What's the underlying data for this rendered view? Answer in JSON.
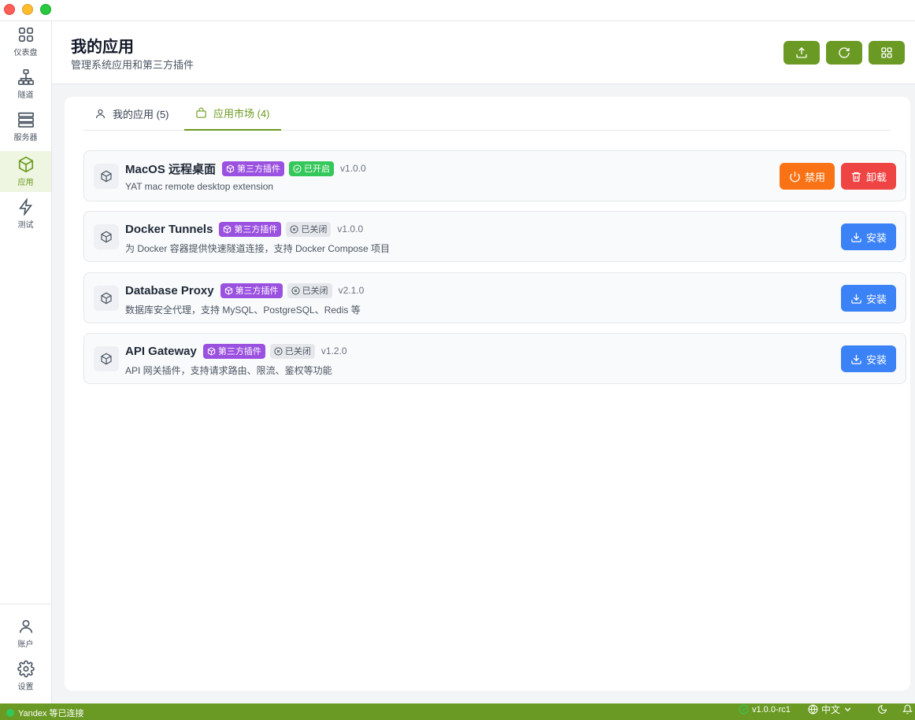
{
  "header": {
    "title": "我的应用",
    "subtitle": "管理系统应用和第三方插件",
    "buttons": [
      "upload-icon",
      "refresh-icon",
      "grid-icon"
    ]
  },
  "sidebar": {
    "items": [
      {
        "label": "仪表盘",
        "icon": "grid-icon"
      },
      {
        "label": "隧道",
        "icon": "network-icon"
      },
      {
        "label": "服务器",
        "icon": "server-icon"
      },
      {
        "label": "应用",
        "icon": "package-icon",
        "active": true
      },
      {
        "label": "测试",
        "icon": "bolt-icon"
      }
    ],
    "bottom": [
      {
        "label": "账户",
        "icon": "user-icon"
      },
      {
        "label": "设置",
        "icon": "gear-icon"
      }
    ]
  },
  "tabs": [
    {
      "label": "我的应用 (5)",
      "icon": "user-icon"
    },
    {
      "label": "应用市场 (4)",
      "icon": "bag-icon",
      "active": true
    }
  ],
  "apps": [
    {
      "name": "MacOS 远程桌面",
      "type_badge": "第三方插件",
      "status": "已开启",
      "version": "v1.0.0",
      "description": "YAT mac remote desktop extension",
      "actions": [
        "禁用",
        "卸载"
      ]
    },
    {
      "name": "Docker Tunnels",
      "type_badge": "第三方插件",
      "status": "已关闭",
      "version": "v1.0.0",
      "description": "为 Docker 容器提供快速隧道连接，支持 Docker Compose 项目",
      "actions": [
        "安装"
      ]
    },
    {
      "name": "Database Proxy",
      "type_badge": "第三方插件",
      "status": "已关闭",
      "version": "v2.1.0",
      "description": "数据库安全代理，支持 MySQL、PostgreSQL、Redis 等",
      "actions": [
        "安装"
      ]
    },
    {
      "name": "API Gateway",
      "type_badge": "第三方插件",
      "status": "已关闭",
      "version": "v1.2.0",
      "description": "API 网关插件，支持请求路由、限流、鉴权等功能",
      "actions": [
        "安装"
      ]
    }
  ],
  "statusbar": {
    "connection": "Yandex 等已连接",
    "version": "v1.0.0-rc1",
    "language": "中文"
  },
  "colors": {
    "accent": "#6a9a23",
    "plugin_badge": "#9b51e0",
    "enabled_badge": "#34c759",
    "disable_button": "#f97316",
    "uninstall_button": "#ef4444",
    "install_button": "#3b82f6"
  }
}
